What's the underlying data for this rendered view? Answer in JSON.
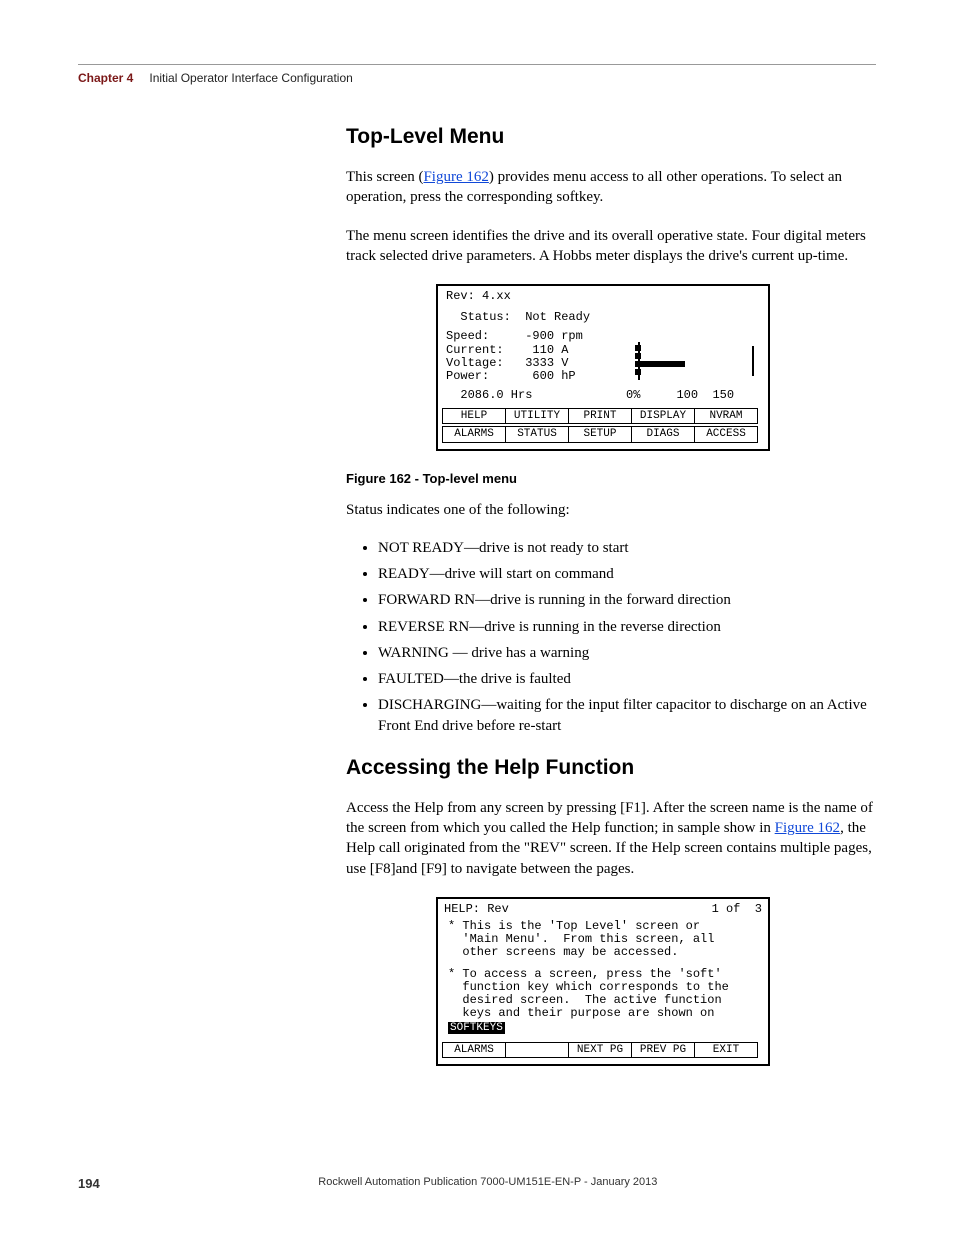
{
  "header": {
    "chapterLabel": "Chapter 4",
    "chapterTitle": "Initial Operator Interface Configuration"
  },
  "section1": {
    "heading": "Top-Level Menu",
    "para1_pre": "This screen (",
    "para1_link": "Figure 162",
    "para1_post": ") provides menu access to all other operations. To select an operation, press the corresponding softkey.",
    "para2": "The menu screen identifies the drive and its overall operative state. Four digital meters track selected drive parameters. A Hobbs meter displays the drive's current up-time."
  },
  "screenshot1": {
    "rev": "Rev: 4.xx",
    "status": "  Status:  Not Ready",
    "m1": "Speed:     -900 rpm",
    "m2": "Current:    110 A",
    "m3": "Voltage:   3333 V",
    "m4": "Power:      600 hP",
    "hobbs": "  2086.0 Hrs",
    "barlbl0": "0%",
    "barlbl100": "100",
    "barlbl150": "150",
    "softkeys_row1": [
      "HELP",
      "UTILITY",
      "PRINT",
      "DISPLAY",
      "NVRAM"
    ],
    "softkeys_row2": [
      "ALARMS",
      "STATUS",
      "SETUP",
      "DIAGS",
      "ACCESS"
    ]
  },
  "figure1Caption": "Figure 162 - Top-level menu",
  "statusIntro": "Status indicates one of the following:",
  "statusList": [
    "NOT READY—drive is not ready to start",
    "READY—drive will start on command",
    "FORWARD RN—drive is running in the forward direction",
    "REVERSE RN—drive is running in the reverse direction",
    "WARNING — drive has a warning",
    "FAULTED—the drive is faulted",
    "DISCHARGING—waiting for the input filter capacitor to discharge on an Active Front End drive before re-start"
  ],
  "section2": {
    "heading": "Accessing the Help Function",
    "para_pre": "Access the Help from any screen by pressing [F1]. After the screen name is the name of the screen from which you called the Help function; in sample show in ",
    "para_link": "Figure 162",
    "para_post": ", the Help call originated from the \"REV\" screen. If the Help screen contains multiple pages, use [F8]and [F9] to navigate between the pages."
  },
  "screenshot2": {
    "title_left": "HELP: Rev",
    "title_right": "1 of  3",
    "body1": "* This is the 'Top Level' screen or\n  'Main Menu'.  From this screen, all\n  other screens may be accessed.",
    "body2": "* To access a screen, press the 'soft'\n  function key which corresponds to the\n  desired screen.  The active function\n  keys and their purpose are shown on",
    "highlight": "SOFTKEYS",
    "softkeys": [
      "ALARMS",
      "",
      "NEXT PG",
      "PREV PG",
      "EXIT"
    ]
  },
  "footer": {
    "pageNumber": "194",
    "pub": "Rockwell Automation Publication 7000-UM151E-EN-P - January 2013"
  }
}
